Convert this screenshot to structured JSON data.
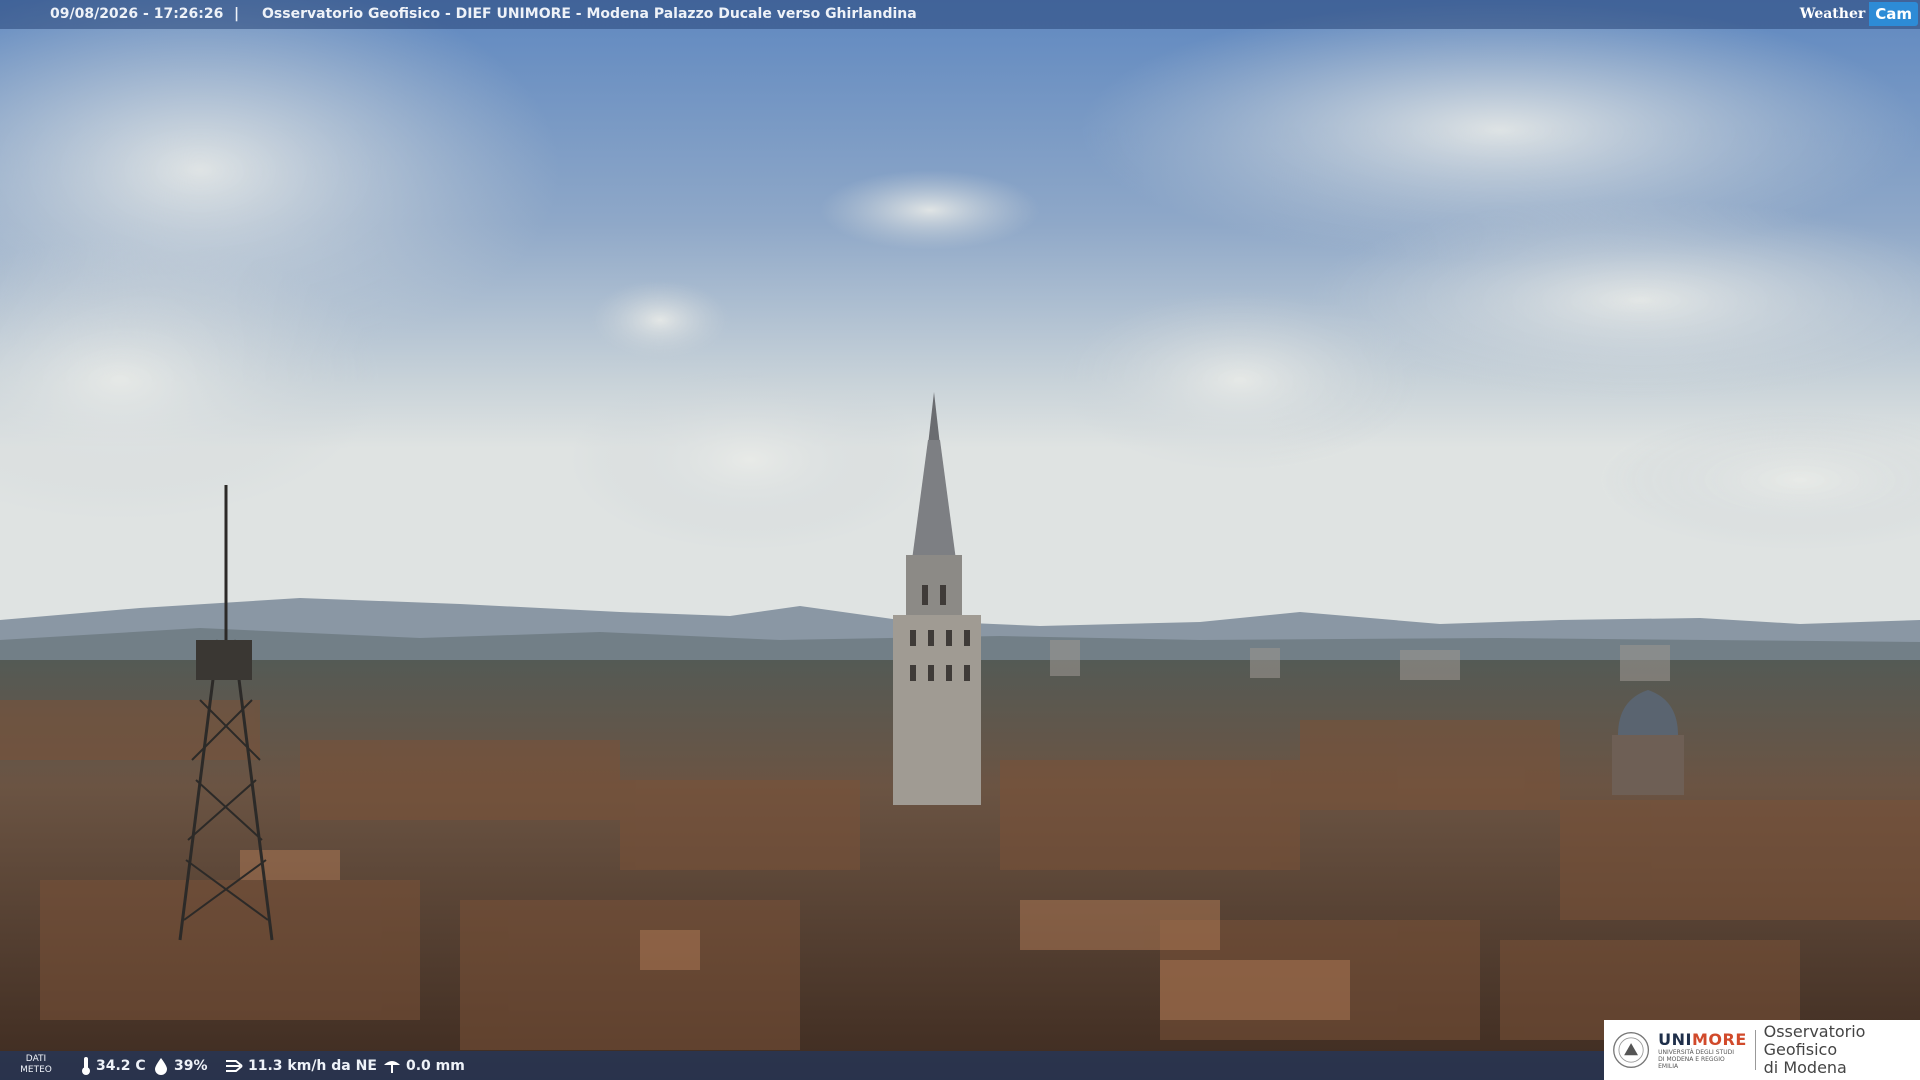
{
  "header": {
    "datetime": "09/08/2026 - 17:26:26",
    "separator": "|",
    "location": "Osservatorio Geofisico - DIEF UNIMORE - Modena Palazzo Ducale verso Ghirlandina",
    "brand_weather": "Weather",
    "brand_cam": "Cam"
  },
  "footer": {
    "dati_line1": "DATI",
    "dati_line2": "METEO",
    "temperature": "34.2 C",
    "humidity": "39%",
    "wind": "11.3 km/h da NE",
    "rain": "0.0 mm",
    "icons": [
      "thermometer-icon",
      "humidity-drop-icon",
      "wind-icon",
      "rain-gauge-icon"
    ]
  },
  "logo": {
    "uni_prefix": "UNI",
    "uni_suffix": "MORE",
    "uni_subtitle": "UNIVERSITÀ DEGLI STUDI DI MODENA E REGGIO EMILIA",
    "observatory_line1": "Osservatorio Geofisico",
    "observatory_line2": "di Modena"
  },
  "colors": {
    "sky_top": "#5f88c0",
    "sky_horizon": "#d9dee0",
    "roofs": "#6e4a34",
    "brand_blue": "#2d8bd6",
    "uni_red": "#d14a2b"
  }
}
